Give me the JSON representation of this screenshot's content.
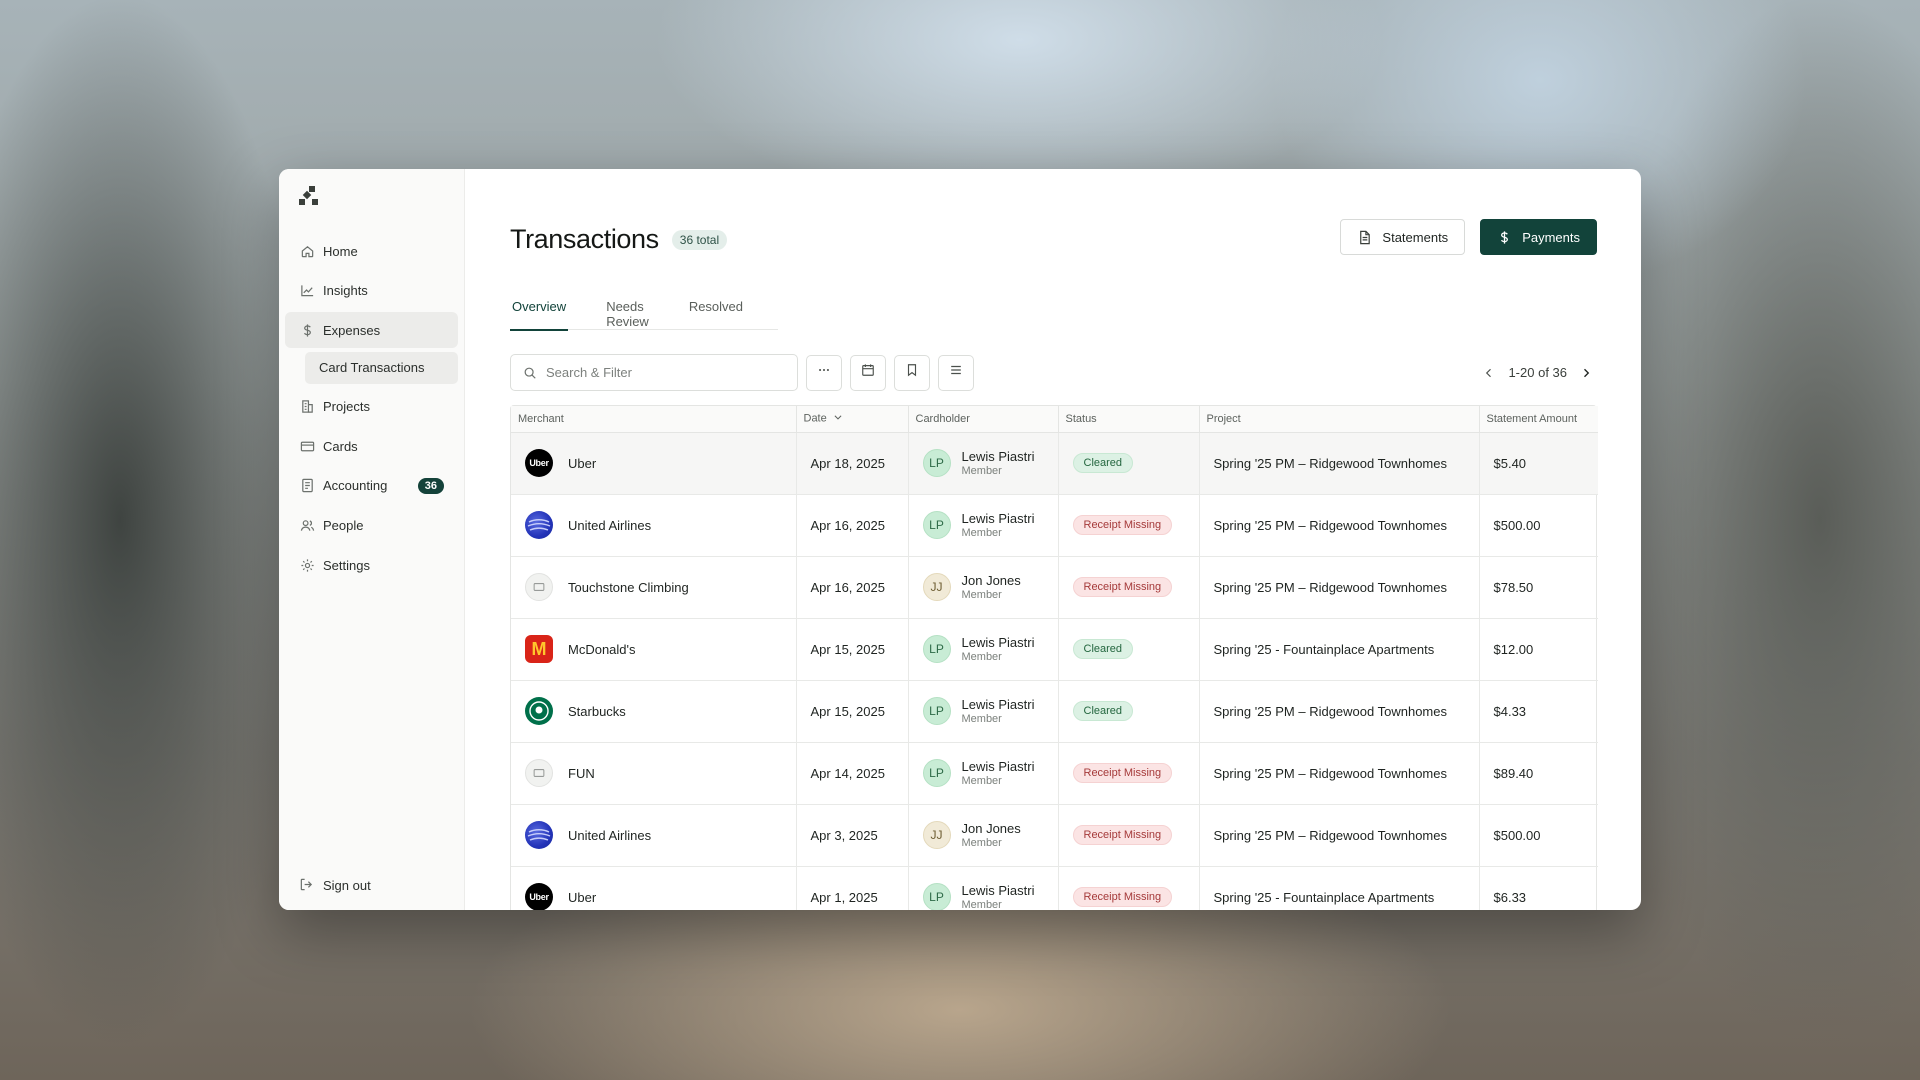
{
  "sidebar": {
    "items": [
      {
        "label": "Home",
        "icon": "home-icon"
      },
      {
        "label": "Insights",
        "icon": "chart-line-icon"
      },
      {
        "label": "Expenses",
        "icon": "dollar-icon"
      },
      {
        "label": "Projects",
        "icon": "building-icon"
      },
      {
        "label": "Cards",
        "icon": "credit-card-icon"
      },
      {
        "label": "Accounting",
        "icon": "ledger-icon",
        "badge": "36"
      },
      {
        "label": "People",
        "icon": "users-icon"
      },
      {
        "label": "Settings",
        "icon": "gear-icon"
      }
    ],
    "sub_item": "Card Transactions",
    "sign_out": "Sign out"
  },
  "header": {
    "title": "Transactions",
    "total_badge": "36 total",
    "statements_label": "Statements",
    "payments_label": "Payments"
  },
  "tabs": [
    "Overview",
    "Needs Review",
    "Resolved"
  ],
  "toolbar": {
    "search_placeholder": "Search & Filter",
    "pagination": "1-20 of 36"
  },
  "table": {
    "columns": [
      "Merchant",
      "Date",
      "Cardholder",
      "Status",
      "Project",
      "Statement Amount"
    ],
    "rows": [
      {
        "merchant": "Uber",
        "logo": "Uber",
        "date": "Apr 18, 2025",
        "initials": "LP",
        "name": "Lewis Piastri",
        "role": "Member",
        "status": "Cleared",
        "project": "Spring '25 PM – Ridgewood Townhomes",
        "amount": "$5.40"
      },
      {
        "merchant": "United Airlines",
        "logo": "",
        "date": "Apr 16, 2025",
        "initials": "LP",
        "name": "Lewis Piastri",
        "role": "Member",
        "status": "Receipt Missing",
        "project": "Spring '25 PM – Ridgewood Townhomes",
        "amount": "$500.00"
      },
      {
        "merchant": "Touchstone Climbing",
        "logo": "",
        "date": "Apr 16, 2025",
        "initials": "JJ",
        "name": "Jon Jones",
        "role": "Member",
        "status": "Receipt Missing",
        "project": "Spring '25 PM – Ridgewood Townhomes",
        "amount": "$78.50"
      },
      {
        "merchant": "McDonald's",
        "logo": "M",
        "date": "Apr 15, 2025",
        "initials": "LP",
        "name": "Lewis Piastri",
        "role": "Member",
        "status": "Cleared",
        "project": "Spring '25 - Fountainplace Apartments",
        "amount": "$12.00"
      },
      {
        "merchant": "Starbucks",
        "logo": "",
        "date": "Apr 15, 2025",
        "initials": "LP",
        "name": "Lewis Piastri",
        "role": "Member",
        "status": "Cleared",
        "project": "Spring '25 PM – Ridgewood Townhomes",
        "amount": "$4.33"
      },
      {
        "merchant": "FUN",
        "logo": "",
        "date": "Apr 14, 2025",
        "initials": "LP",
        "name": "Lewis Piastri",
        "role": "Member",
        "status": "Receipt Missing",
        "project": "Spring '25 PM – Ridgewood Townhomes",
        "amount": "$89.40"
      },
      {
        "merchant": "United Airlines",
        "logo": "",
        "date": "Apr 3, 2025",
        "initials": "JJ",
        "name": "Jon Jones",
        "role": "Member",
        "status": "Receipt Missing",
        "project": "Spring '25 PM – Ridgewood Townhomes",
        "amount": "$500.00"
      },
      {
        "merchant": "Uber",
        "logo": "Uber",
        "date": "Apr 1, 2025",
        "initials": "LP",
        "name": "Lewis Piastri",
        "role": "Member",
        "status": "Receipt Missing",
        "project": "Spring '25 - Fountainplace Apartments",
        "amount": "$6.33"
      }
    ]
  },
  "colors": {
    "accent": "#12433a",
    "cleared": "#24663f",
    "missing": "#a53a3a"
  }
}
